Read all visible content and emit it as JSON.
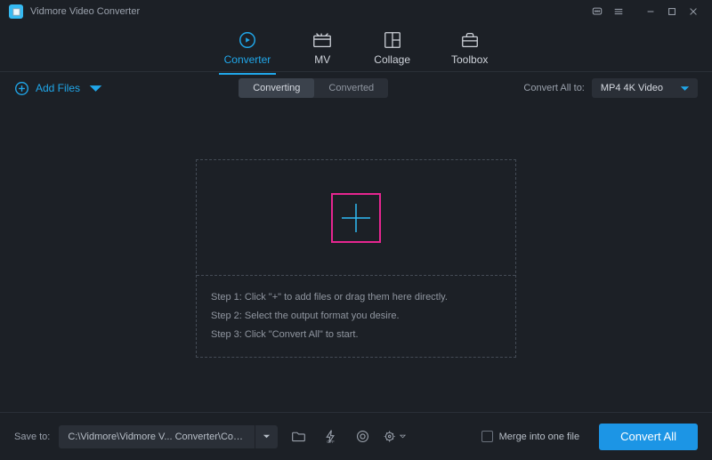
{
  "app": {
    "title": "Vidmore Video Converter"
  },
  "tabs": [
    {
      "label": "Converter"
    },
    {
      "label": "MV"
    },
    {
      "label": "Collage"
    },
    {
      "label": "Toolbox"
    }
  ],
  "toolbar": {
    "add_files": "Add Files",
    "converting": "Converting",
    "converted": "Converted",
    "convert_all_to": "Convert All to:",
    "format_selected": "MP4 4K Video"
  },
  "dropzone": {
    "step1": "Step 1: Click \"+\" to add files or drag them here directly.",
    "step2": "Step 2: Select the output format you desire.",
    "step3": "Step 3: Click \"Convert All\" to start."
  },
  "bottom": {
    "save_to": "Save to:",
    "path": "C:\\Vidmore\\Vidmore V... Converter\\Converted",
    "merge": "Merge into one file",
    "convert_all": "Convert All"
  }
}
